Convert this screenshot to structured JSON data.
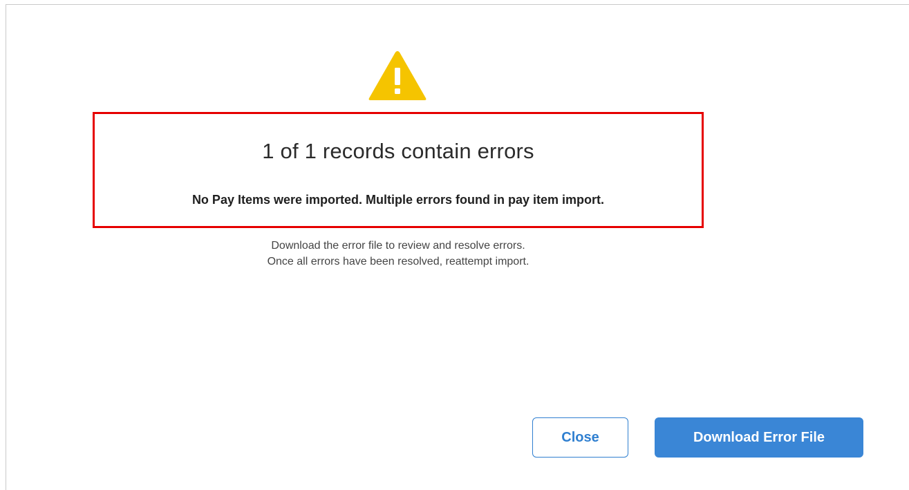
{
  "dialog": {
    "icon": "warning-icon",
    "heading": "1 of 1 records contain errors",
    "subheading": "No Pay Items were imported. Multiple errors found in pay item import.",
    "message_line1": "Download the error file to review and resolve errors.",
    "message_line2": "Once all errors have been resolved, reattempt import.",
    "close_label": "Close",
    "download_label": "Download Error File"
  },
  "colors": {
    "warning": "#f5c400",
    "highlight_border": "#e60000",
    "primary": "#3a86d6"
  }
}
